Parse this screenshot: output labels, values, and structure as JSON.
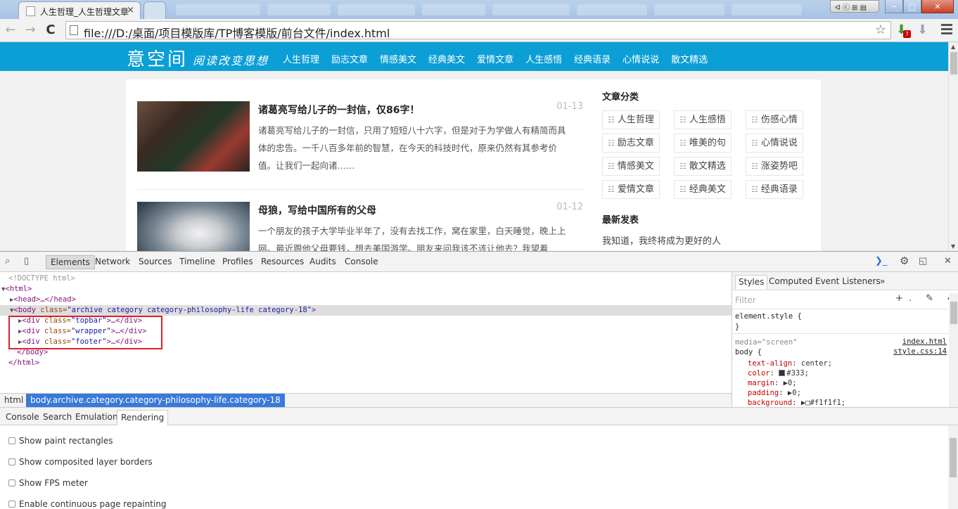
{
  "window": {
    "tab_active_title": "人生哲理_人生哲理文章阅",
    "system_badge": "ᐊ ⓒ ⊞ ▤",
    "min_glyph": "─",
    "max_glyph": "□",
    "close_glyph": "✕",
    "tab_close_glyph": "×"
  },
  "toolbar": {
    "back_glyph": "←",
    "forward_glyph": "→",
    "reload_glyph": "C",
    "url": "file:///D:/桌面/项目模版库/TP博客模版/前台文件/index.html",
    "star_glyph": "☆",
    "ext_badge": "?",
    "download_glyph": "⬇"
  },
  "site": {
    "logo": "意空间",
    "slogan": "阅读改变思想",
    "nav": [
      "人生哲理",
      "励志文章",
      "情感美文",
      "经典美文",
      "爱情文章",
      "人生感悟",
      "经典语录",
      "心情说说",
      "散文精选"
    ],
    "articles": [
      {
        "title": "诸葛亮写给儿子的一封信，仅86字！",
        "date": "01-13",
        "desc": "诸葛亮写给儿子的一封信，只用了短短八十六字，但是对于为学做人有精简而具体的忠告。一千八百多年前的智慧，在今天的科技时代，原来仍然有其参考价值。让我们一起向诸……"
      },
      {
        "title": "母狼，写给中国所有的父母",
        "date": "01-12",
        "desc": "一个朋友的孩子大学毕业半年了，没有去找工作，窝在家里，白天睡觉，晚上上网。最近跟他父母要钱，想去美国游学。朋友来问我该不该让他去？我望着"
      }
    ],
    "sidebar": {
      "category_heading": "文章分类",
      "categories": [
        "人生哲理",
        "人生感悟",
        "伤感心情",
        "励志文章",
        "唯美的句",
        "心情说说",
        "情感美文",
        "散文精选",
        "涨姿势吧",
        "爱情文章",
        "经典美文",
        "经典语录"
      ],
      "latest_heading": "最新发表",
      "latest_first": "我知道，我终将成为更好的人"
    }
  },
  "devtools": {
    "tabs": [
      "Elements",
      "Network",
      "Sources",
      "Timeline",
      "Profiles",
      "Resources",
      "Audits",
      "Console"
    ],
    "dom": {
      "doctype": "<!DOCTYPE html>",
      "html_open": "<html>",
      "head": "<head>…</head>",
      "body_tag": "<body ",
      "body_attr": "class=",
      "body_val": "\"archive category category-philosophy-life category-18\"",
      "body_close": ">",
      "div_open": "<div ",
      "div_attr": "class=",
      "div_topbar": "\"topbar\"",
      "div_wrapper": "\"wrapper\"",
      "div_footer": "\"footer\"",
      "div_end": ">…</div>",
      "body_end": "</body>",
      "html_end": "</html>"
    },
    "breadcrumb": [
      "html",
      "body.archive.category.category-philosophy-life.category-18"
    ],
    "styles_tabs": [
      "Styles",
      "Computed",
      "Event Listeners",
      "»"
    ],
    "styles": {
      "filter_placeholder": "Filter",
      "tools": "+. ✎ ◆",
      "element_style": "element.style {",
      "close_brace": "}",
      "media": "media=\"screen\"",
      "media_link": "index.html",
      "rule_selector": "body {",
      "rule_link": "style.css:14",
      "decls": [
        {
          "prop": "text-align",
          "val": "center;"
        },
        {
          "prop": "color",
          "val": "#333;"
        },
        {
          "prop": "margin",
          "val": "▶0;"
        },
        {
          "prop": "padding",
          "val": "▶0;"
        },
        {
          "prop": "background",
          "val": "▶□#f1f1f1;"
        }
      ]
    },
    "drawer_tabs": [
      "Console",
      "Search",
      "Emulation",
      "Rendering"
    ],
    "rendering_options": [
      "Show paint rectangles",
      "Show composited layer borders",
      "Show FPS meter",
      "Enable continuous page repainting"
    ],
    "colors": {
      "selection": "#3879d9",
      "highlight_box": "#e0202a",
      "site_blue": "#0b9fd6"
    }
  }
}
